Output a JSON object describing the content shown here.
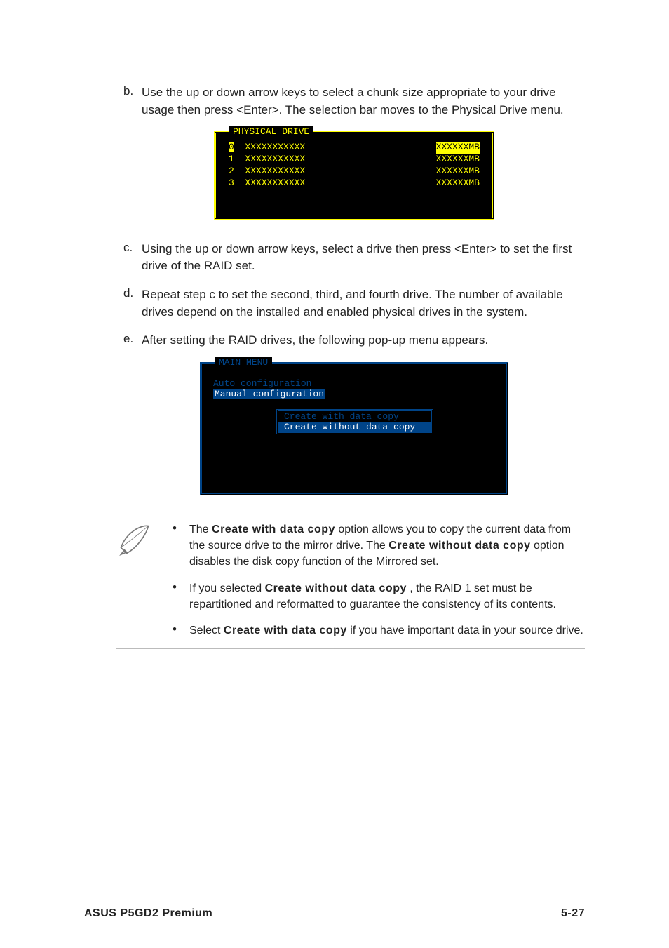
{
  "steps": {
    "b": {
      "letter": "b.",
      "text": "Use the up or down arrow keys to select a chunk size appropriate to your drive usage then press <Enter>. The selection bar moves to the Physical Drive menu."
    },
    "c": {
      "letter": "c.",
      "text": "Using the up or down arrow keys, select a drive then press <Enter> to set the first drive of the RAID set."
    },
    "d": {
      "letter": "d.",
      "text": "Repeat step c to set the second, third, and fourth drive. The number of available drives depend on the installed and enabled physical drives in the system."
    },
    "e": {
      "letter": "e.",
      "text": "After setting the RAID drives, the following pop-up menu appears."
    }
  },
  "terminal1": {
    "title": "PHYSICAL DRIVE",
    "rows": [
      {
        "idx": "0",
        "name": "XXXXXXXXXXX",
        "size": "XXXXXXMB",
        "hl": true
      },
      {
        "idx": "1",
        "name": "XXXXXXXXXXX",
        "size": "XXXXXXMB",
        "hl": false
      },
      {
        "idx": "2",
        "name": "XXXXXXXXXXX",
        "size": "XXXXXXMB",
        "hl": false
      },
      {
        "idx": "3",
        "name": "XXXXXXXXXXX",
        "size": "XXXXXXMB",
        "hl": false
      }
    ]
  },
  "terminal2": {
    "title": "MAIN MENU",
    "auto": "Auto configuration",
    "manual": "Manual configuration",
    "sub1": "Create with data copy",
    "sub2": "Create without data copy"
  },
  "notes": {
    "n1a": "The ",
    "n1b": "Create with data copy",
    "n1c": " option allows you to copy the current data from the source drive to the mirror drive. The ",
    "n1d": "Create without data copy",
    "n1e": " option disables the disk copy function of the Mirrored set.",
    "n2a": "If you selected ",
    "n2b": "Create without data copy",
    "n2c": " , the RAID 1 set must be repartitioned and reformatted to guarantee the consistency of its contents.",
    "n3a": "Select ",
    "n3b": "Create with data copy",
    "n3c": " if you have important data in your source drive."
  },
  "footer": {
    "left": "ASUS P5GD2 Premium",
    "right": "5-27"
  },
  "bullet": "•"
}
